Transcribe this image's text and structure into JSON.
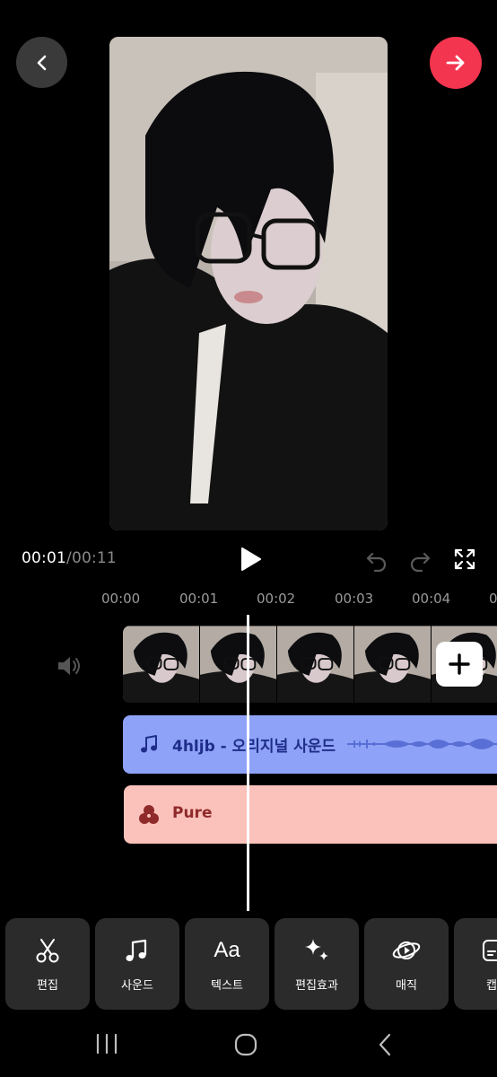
{
  "playback": {
    "current_time": "00:01",
    "separator": "/",
    "total_time": "00:11"
  },
  "ruler": {
    "ticks": [
      "00:00",
      "00:01",
      "00:02",
      "00:03",
      "00:04",
      "0"
    ]
  },
  "tracks": {
    "sound_label": "4hljb - 오리지널 사운드",
    "filter_label": "Pure"
  },
  "toolbar": {
    "items": [
      {
        "label": "편집",
        "icon": "scissors-icon"
      },
      {
        "label": "사운드",
        "icon": "music-note-icon"
      },
      {
        "label": "텍스트",
        "icon": "text-aa-icon",
        "icon_text": "Aa"
      },
      {
        "label": "편집효과",
        "icon": "sparkles-icon"
      },
      {
        "label": "매직",
        "icon": "magic-planet-icon"
      },
      {
        "label": "캡",
        "icon": "caption-icon"
      }
    ]
  },
  "colors": {
    "next_button": "#f4354f",
    "sound_track": "#8ea2f7",
    "filter_track": "#fbc1bb",
    "tool_tile": "#2b2b2b"
  }
}
